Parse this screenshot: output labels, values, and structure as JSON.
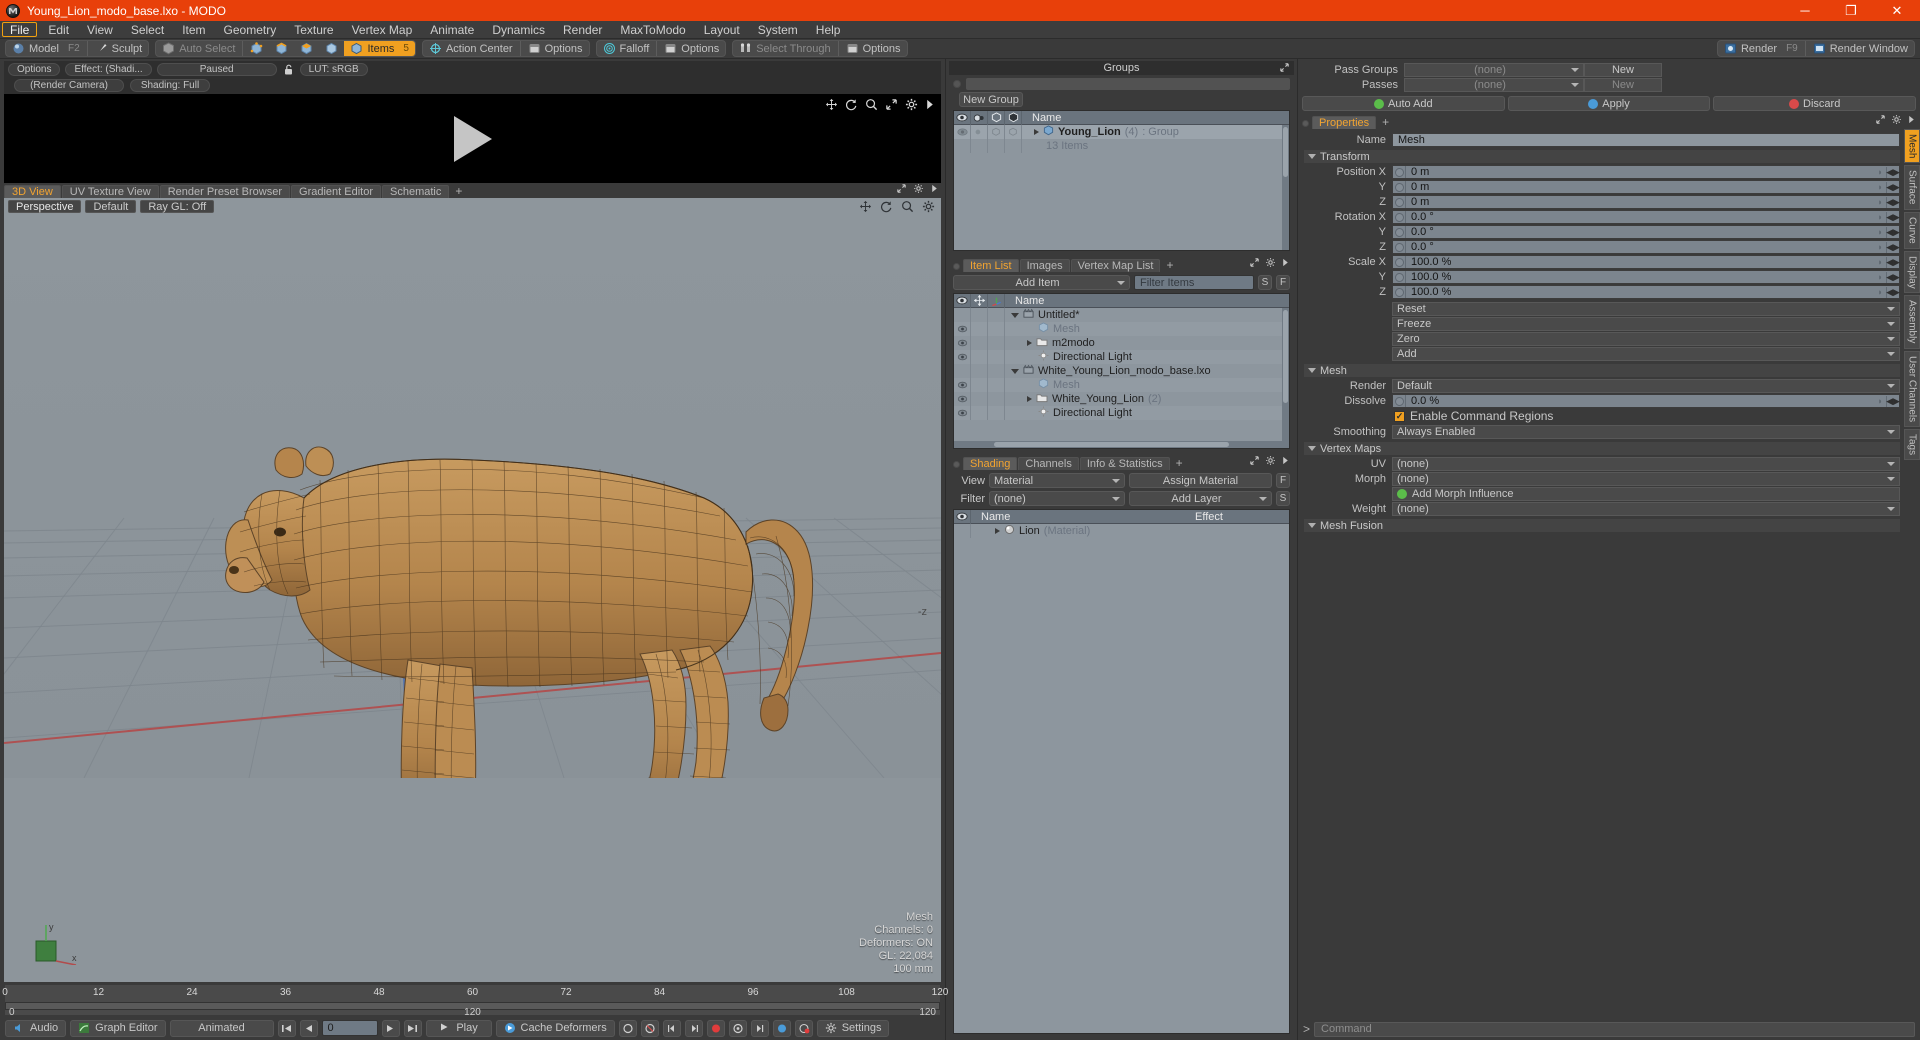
{
  "window": {
    "title": "Young_Lion_modo_base.lxo - MODO",
    "minimize": "─",
    "maximize": "❐",
    "close": "✕",
    "titlebar_color": "#e8400a"
  },
  "menubar": {
    "items": [
      {
        "label": "File",
        "selected": true
      },
      {
        "label": "Edit",
        "selected": false
      },
      {
        "label": "View",
        "selected": false
      },
      {
        "label": "Select",
        "selected": false
      },
      {
        "label": "Item",
        "selected": false
      },
      {
        "label": "Geometry",
        "selected": false
      },
      {
        "label": "Texture",
        "selected": false
      },
      {
        "label": "Vertex Map",
        "selected": false
      },
      {
        "label": "Animate",
        "selected": false
      },
      {
        "label": "Dynamics",
        "selected": false
      },
      {
        "label": "Render",
        "selected": false
      },
      {
        "label": "MaxToModo",
        "selected": false
      },
      {
        "label": "Layout",
        "selected": false
      },
      {
        "label": "System",
        "selected": false
      },
      {
        "label": "Help",
        "selected": false
      }
    ]
  },
  "modebar": {
    "model_label": "Model",
    "model_key": "F2",
    "sculpt_label": "Sculpt",
    "auto_select_label": "Auto Select",
    "items_label": "Items",
    "items_key": "5",
    "action_center_label": "Action Center",
    "options_label_1": "Options",
    "falloff_label": "Falloff",
    "options_label_2": "Options",
    "select_through_label": "Select Through",
    "options_label_3": "Options",
    "render_label": "Render",
    "render_key": "F9",
    "render_window_label": "Render Window"
  },
  "preview": {
    "options_label": "Options",
    "effect_label": "Effect: (Shadi...",
    "paused_label": "Paused",
    "lut_label": "LUT: sRGB",
    "render_camera_label": "(Render Camera)",
    "shading_label": "Shading: Full",
    "icons": [
      "pan-icon",
      "refresh-icon",
      "zoom-icon",
      "fit-icon",
      "gear-icon",
      "play-arrow-icon"
    ]
  },
  "viewport_tabs": {
    "tabs": [
      {
        "label": "3D View",
        "selected": true
      },
      {
        "label": "UV Texture View",
        "selected": false
      },
      {
        "label": "Render Preset Browser",
        "selected": false
      },
      {
        "label": "Gradient Editor",
        "selected": false
      },
      {
        "label": "Schematic",
        "selected": false
      }
    ],
    "plus": "+"
  },
  "viewport": {
    "perspective_label": "Perspective",
    "default_label": "Default",
    "raygl_label": "Ray GL: Off",
    "z_axis_label": "-z",
    "stats": {
      "mesh": "Mesh",
      "channels": "Channels: 0",
      "deformers": "Deformers: ON",
      "gl": "GL: 22,084",
      "scale": "100 mm"
    },
    "gizmo_axes": [
      "y",
      "x"
    ]
  },
  "timeline": {
    "ticks": [
      {
        "label": "0",
        "pos": 0
      },
      {
        "label": "12",
        "pos": 10
      },
      {
        "label": "24",
        "pos": 20
      },
      {
        "label": "36",
        "pos": 30
      },
      {
        "label": "48",
        "pos": 40
      },
      {
        "label": "60",
        "pos": 50
      },
      {
        "label": "72",
        "pos": 60
      },
      {
        "label": "84",
        "pos": 70
      },
      {
        "label": "96",
        "pos": 80
      },
      {
        "label": "108",
        "pos": 90
      },
      {
        "label": "120",
        "pos": 100
      }
    ],
    "start_label": "0",
    "mid_label": "120",
    "end_label": "120"
  },
  "bottombar": {
    "audio_label": "Audio",
    "graph_editor_label": "Graph Editor",
    "animated_label": "Animated",
    "frame_value": "0",
    "play_label": "Play",
    "cache_deformers_label": "Cache Deformers",
    "settings_label": "Settings",
    "transport": [
      "skip-start-icon",
      "step-back-icon",
      "step-forward-icon",
      "fast-forward-icon"
    ],
    "record_icons": [
      "key-icon",
      "no-key-icon",
      "prev-key-icon",
      "next-key-icon",
      "record-icon",
      "autokey-icon",
      "end-key-icon",
      "color-key-icon",
      "clear-key-icon"
    ]
  },
  "groups_panel": {
    "title": "Groups",
    "new_group_button": "New Group",
    "columns": [
      "eye-icon",
      "render-icon",
      "lock-icon",
      "select-icon",
      "Name"
    ],
    "name_column": "Name",
    "rows": [
      {
        "name": "Young_Lion",
        "count": "(4)",
        "type": ": Group",
        "sub": "13 Items"
      }
    ]
  },
  "item_list_panel": {
    "tabs": [
      {
        "label": "Item List",
        "selected": true
      },
      {
        "label": "Images",
        "selected": false
      },
      {
        "label": "Vertex Map List",
        "selected": false
      }
    ],
    "plus": "+",
    "add_item_label": "Add Item",
    "filter_placeholder": "Filter Items",
    "filter_s": "S",
    "filter_f": "F",
    "name_column": "Name",
    "columns": [
      "eye-icon",
      "move-icon",
      "axis-icon"
    ],
    "rows": [
      {
        "name": "Untitled*",
        "icon": "scene-icon",
        "indent": 0,
        "expander": "open",
        "eye": false,
        "dim": false
      },
      {
        "name": "Mesh",
        "icon": "mesh-icon",
        "indent": 1,
        "expander": "leaf",
        "eye": true,
        "dim": true
      },
      {
        "name": "m2modo",
        "icon": "folder-icon",
        "indent": 1,
        "expander": "closed",
        "eye": true,
        "dim": false
      },
      {
        "name": "Directional Light",
        "icon": "light-icon",
        "indent": 1,
        "expander": "leaf",
        "eye": true,
        "dim": false
      },
      {
        "name": "White_Young_Lion_modo_base.lxo",
        "icon": "scene-icon",
        "indent": 0,
        "expander": "open",
        "eye": false,
        "dim": false
      },
      {
        "name": "Mesh",
        "icon": "mesh-icon",
        "indent": 1,
        "expander": "leaf",
        "eye": true,
        "dim": true
      },
      {
        "name": "White_Young_Lion",
        "icon": "folder-icon",
        "indent": 1,
        "expander": "closed",
        "eye": true,
        "dim": false,
        "count": "(2)"
      },
      {
        "name": "Directional Light",
        "icon": "light-icon",
        "indent": 1,
        "expander": "leaf",
        "eye": true,
        "dim": false
      }
    ]
  },
  "shading_panel": {
    "tabs": [
      {
        "label": "Shading",
        "selected": true
      },
      {
        "label": "Channels",
        "selected": false
      },
      {
        "label": "Info & Statistics",
        "selected": false
      }
    ],
    "plus": "+",
    "view_label": "View",
    "view_value": "Material",
    "assign_material_label": "Assign Material",
    "assign_f": "F",
    "filter_label": "Filter",
    "filter_value": "(none)",
    "add_layer_label": "Add Layer",
    "add_layer_s": "S",
    "name_column": "Name",
    "effect_column": "Effect",
    "rows": [
      {
        "name": "Lion",
        "type": "(Material)",
        "effect": ""
      }
    ]
  },
  "passes_panel": {
    "pass_groups_label": "Pass Groups",
    "pass_groups_value": "(none)",
    "pass_groups_new": "New",
    "passes_label": "Passes",
    "passes_value": "(none)",
    "passes_new": "New",
    "auto_add_label": "Auto Add",
    "apply_label": "Apply",
    "discard_label": "Discard"
  },
  "properties_panel": {
    "tab_label": "Properties",
    "plus": "+",
    "name_label": "Name",
    "name_value": "Mesh",
    "transform_header": "Transform",
    "transform_rows": [
      {
        "label": "Position X",
        "value": "0 m"
      },
      {
        "label": "Y",
        "value": "0 m"
      },
      {
        "label": "Z",
        "value": "0 m"
      },
      {
        "label": "Rotation X",
        "value": "0.0 °"
      },
      {
        "label": "Y",
        "value": "0.0 °"
      },
      {
        "label": "Z",
        "value": "0.0 °"
      },
      {
        "label": "Scale X",
        "value": "100.0 %"
      },
      {
        "label": "Y",
        "value": "100.0 %"
      },
      {
        "label": "Z",
        "value": "100.0 %"
      }
    ],
    "transform_buttons": [
      "Reset",
      "Freeze",
      "Zero",
      "Add"
    ],
    "mesh_header": "Mesh",
    "render_label": "Render",
    "render_value": "Default",
    "dissolve_label": "Dissolve",
    "dissolve_value": "0.0 %",
    "enable_command_regions_label": "Enable Command Regions",
    "enable_command_regions_checked": true,
    "smoothing_label": "Smoothing",
    "smoothing_value": "Always Enabled",
    "vertex_maps_header": "Vertex Maps",
    "uv_label": "UV",
    "uv_value": "(none)",
    "morph_label": "Morph",
    "morph_value": "(none)",
    "add_morph_influence_label": "Add Morph Influence",
    "weight_label": "Weight",
    "weight_value": "(none)",
    "mesh_fusion_header": "Mesh Fusion",
    "side_tabs": [
      {
        "label": "Mesh",
        "selected": true
      },
      {
        "label": "Surface",
        "selected": false
      },
      {
        "label": "Curve",
        "selected": false
      },
      {
        "label": "Display",
        "selected": false
      },
      {
        "label": "Assembly",
        "selected": false
      },
      {
        "label": "User Channels",
        "selected": false
      },
      {
        "label": "Tags",
        "selected": false
      }
    ]
  },
  "command_bar": {
    "prompt": ">",
    "placeholder": "Command"
  },
  "colors": {
    "accent_orange": "#f0a020",
    "title_orange": "#e8400a",
    "panel_bg": "#3a3a3a",
    "list_bg": "#8d969e",
    "field_blue": "#7c858e",
    "viewport_bg": "#8d959b"
  }
}
